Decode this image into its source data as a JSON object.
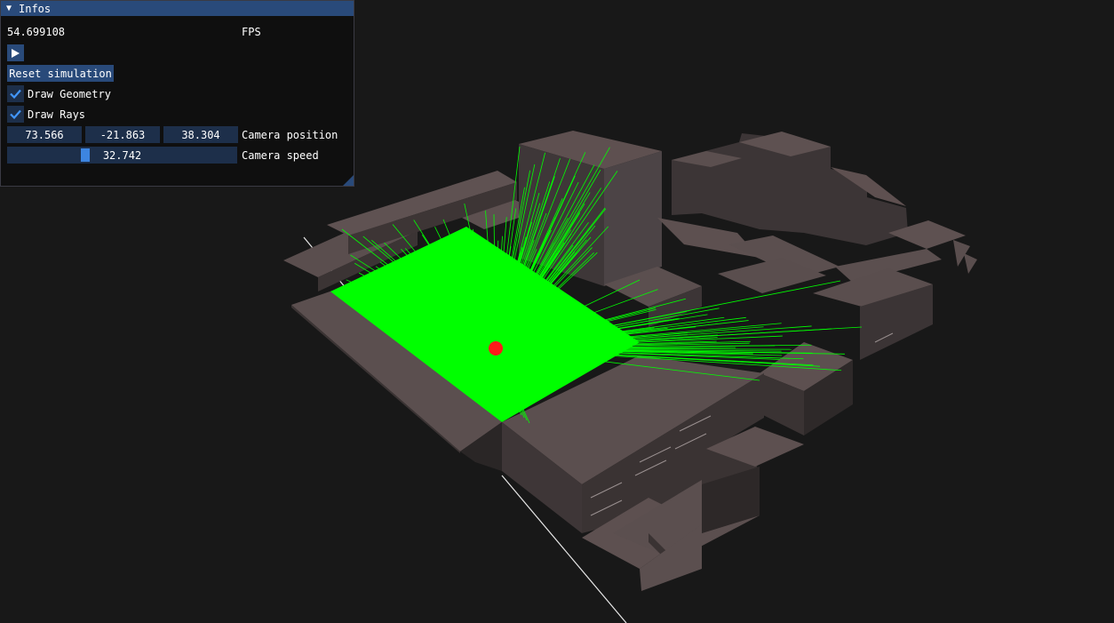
{
  "window": {
    "title": "Infos",
    "fps_value": "54.699108",
    "fps_label": "FPS",
    "reset_button": "Reset simulation",
    "checkboxes": [
      {
        "label": "Draw Geometry",
        "checked": true
      },
      {
        "label": "Draw Rays",
        "checked": true
      }
    ],
    "camera_position": {
      "label": "Camera position",
      "x": "73.566",
      "y": "-21.863",
      "z": "38.304"
    },
    "camera_speed": {
      "label": "Camera speed",
      "value": "32.742",
      "fraction": 0.33
    }
  },
  "colors": {
    "accent": "#294a7a",
    "frame_bg": "#1d2f4a",
    "check": "#4296fa",
    "ray": "#00ff00",
    "source": "#ff1a1a",
    "geometry_top": "#5b4e4e",
    "geometry_side": "#3a3434",
    "background": "#181818"
  }
}
